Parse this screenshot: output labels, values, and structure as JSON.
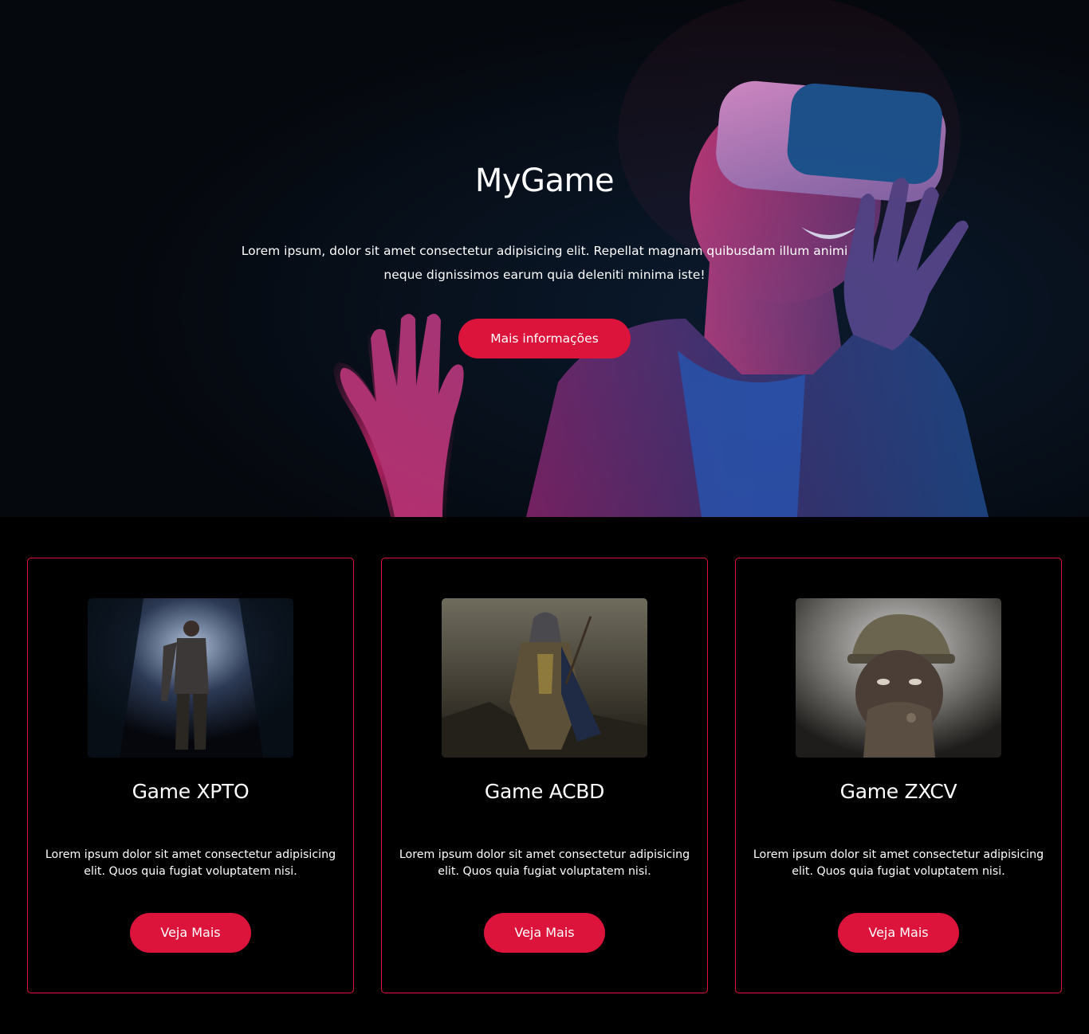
{
  "hero": {
    "title": "MyGame",
    "text": "Lorem ipsum, dolor sit amet consectetur adipisicing elit. Repellat magnam quibusdam illum animi neque dignissimos earum quia deleniti minima iste!",
    "button_label": "Mais informações"
  },
  "games": [
    {
      "title": "Game XPTO",
      "text": "Lorem ipsum dolor sit amet consectetur adipisicing elit. Quos quia fugiat voluptatem nisi.",
      "button_label": "Veja Mais"
    },
    {
      "title": "Game ACBD",
      "text": "Lorem ipsum dolor sit amet consectetur adipisicing elit. Quos quia fugiat voluptatem nisi.",
      "button_label": "Veja Mais"
    },
    {
      "title": "Game ZXCV",
      "text": "Lorem ipsum dolor sit amet consectetur adipisicing elit. Quos quia fugiat voluptatem nisi.",
      "button_label": "Veja Mais"
    }
  ],
  "colors": {
    "accent": "#dc143c",
    "background": "#000000",
    "hero_background": "#05080d",
    "text": "#ffffff"
  }
}
